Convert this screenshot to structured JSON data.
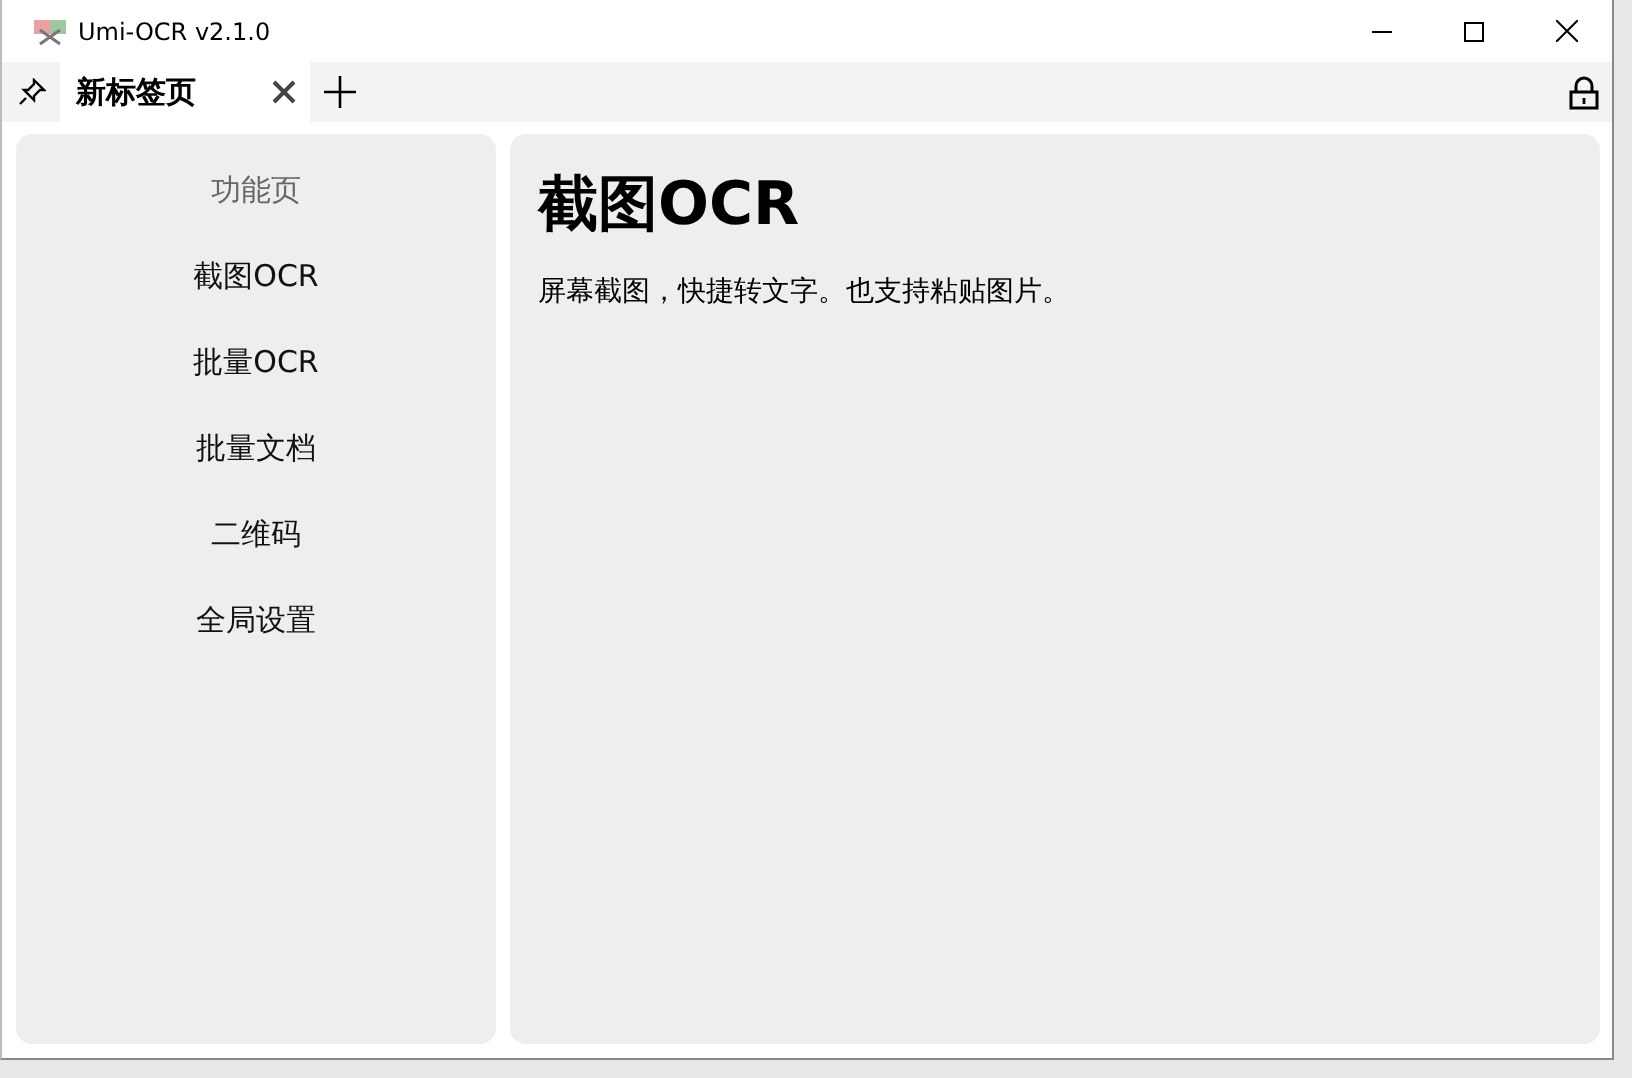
{
  "window": {
    "title": "Umi-OCR v2.1.0"
  },
  "tabs": [
    {
      "label": "新标签页",
      "selected": true
    }
  ],
  "sidebar": {
    "heading": "功能页",
    "items": [
      "截图OCR",
      "批量OCR",
      "批量文档",
      "二维码",
      "全局设置"
    ]
  },
  "main": {
    "title": "截图OCR",
    "description": "屏幕截图，快捷转文字。也支持粘贴图片。"
  }
}
